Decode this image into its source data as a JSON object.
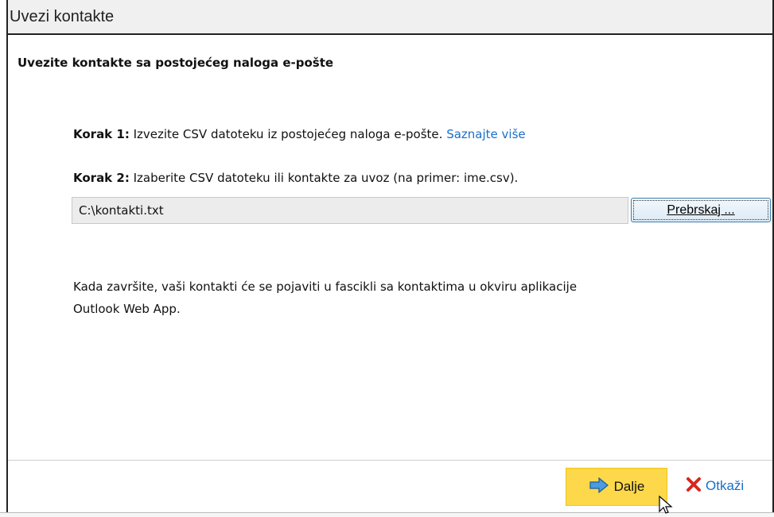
{
  "window": {
    "title": "Uvezi kontakte"
  },
  "main": {
    "heading": "Uvezite kontakte sa postojećeg naloga e-pošte",
    "step1": {
      "label": "Korak 1:",
      "text": " Izvezite CSV datoteku iz postojećeg naloga e-pošte. ",
      "link": "Saznajte više"
    },
    "step2": {
      "label": "Korak 2:",
      "text": " Izaberite CSV datoteku ili kontakte za uvoz (na primer: ime.csv)."
    },
    "file_input": {
      "value": "C:\\kontakti.txt"
    },
    "browse_label": "Prebrskaj ...",
    "info_line1": "Kada završite, vaši kontakti će se pojaviti u fascikli sa kontaktima u okviru aplikacije",
    "info_line2": "Outlook Web App."
  },
  "footer": {
    "next_label": "Dalje",
    "cancel_label": "Otkaži",
    "next_icon": "arrow-right-icon",
    "cancel_icon": "close-icon"
  },
  "colors": {
    "link": "#1a6fc9",
    "primary_button": "#fcd84a",
    "cancel_icon": "#d9261c"
  }
}
